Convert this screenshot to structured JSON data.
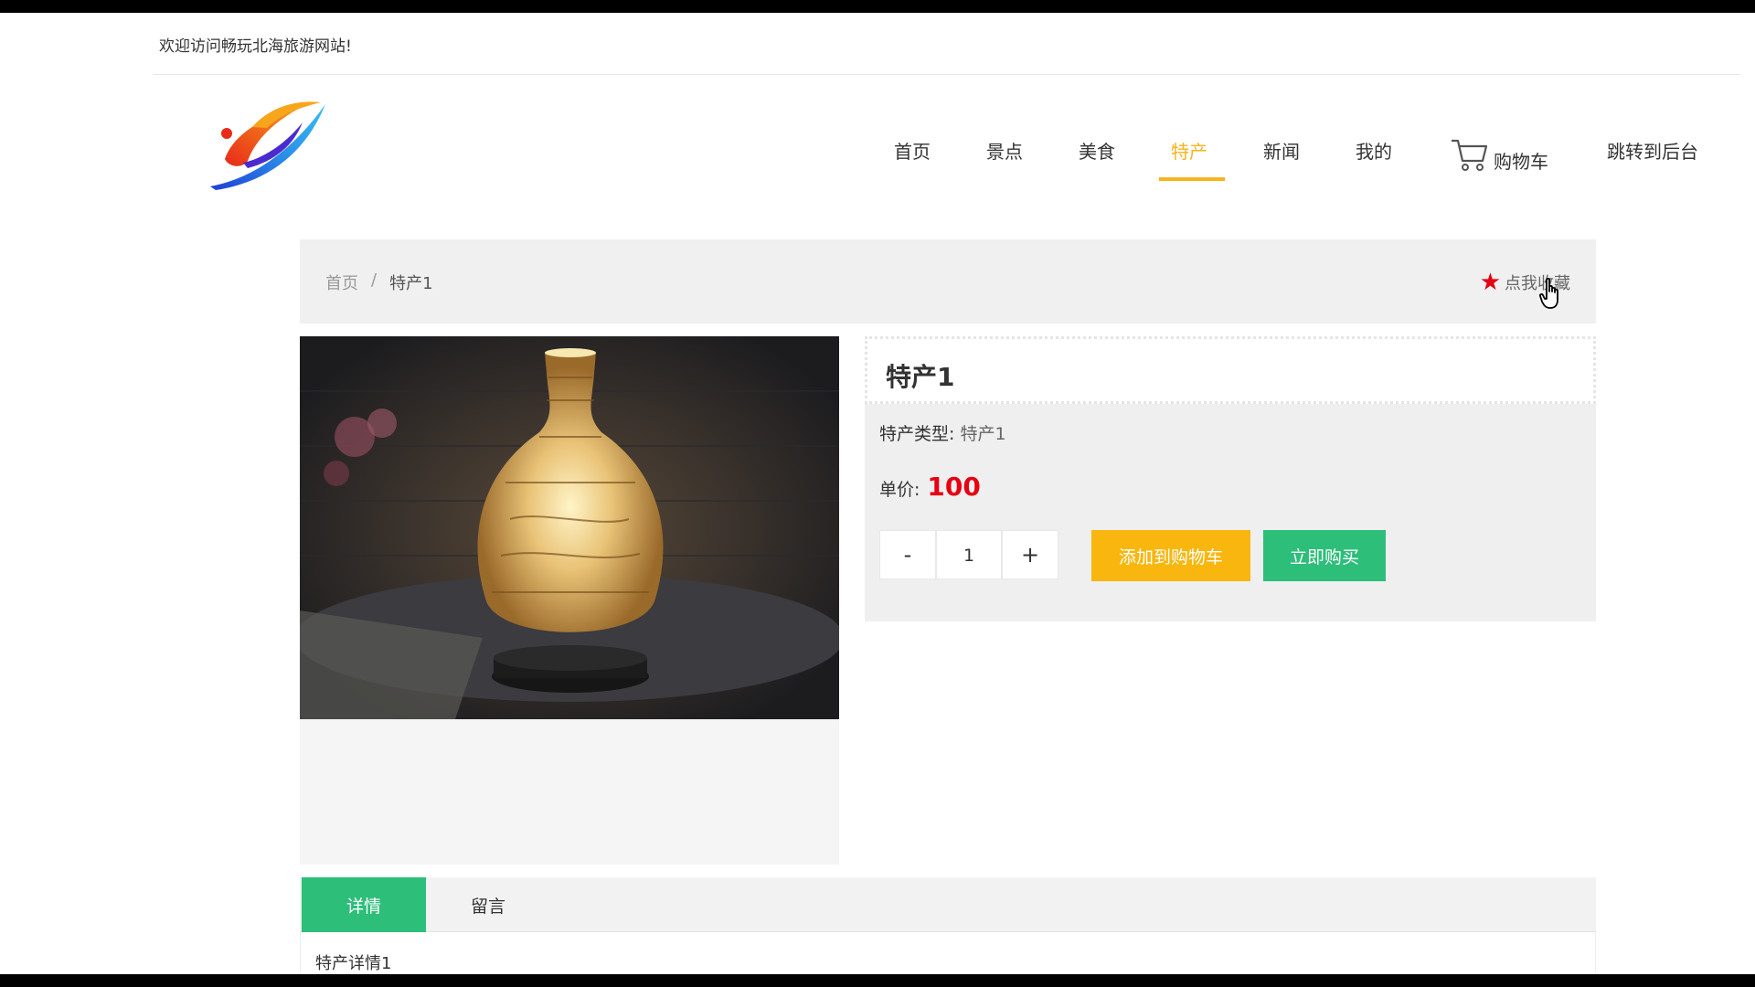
{
  "header": {
    "welcome_text": "欢迎访问畅玩北海旅游网站!"
  },
  "nav": {
    "items": [
      {
        "label": "首页"
      },
      {
        "label": "景点"
      },
      {
        "label": "美食"
      },
      {
        "label": "特产",
        "active": true
      },
      {
        "label": "新闻"
      },
      {
        "label": "我的"
      }
    ],
    "cart_label": "购物车",
    "admin_label": "跳转到后台"
  },
  "breadcrumb": {
    "home": "首页",
    "separator": "/",
    "current": "特产1"
  },
  "favorite": {
    "label": "点我收藏",
    "icon": "star-icon"
  },
  "product": {
    "title": "特产1",
    "type_label": "特产类型:",
    "type_value": "特产1",
    "price_label": "单价:",
    "price_value": "100",
    "quantity": "1",
    "minus_label": "-",
    "plus_label": "+",
    "add_to_cart_label": "添加到购物车",
    "buy_now_label": "立即购买"
  },
  "tabs": {
    "details": "详情",
    "comments": "留言"
  },
  "details": {
    "text": "特产详情1"
  },
  "colors": {
    "accent": "#f5b41f",
    "green": "#2dbe7a",
    "price_red": "#e60012"
  }
}
